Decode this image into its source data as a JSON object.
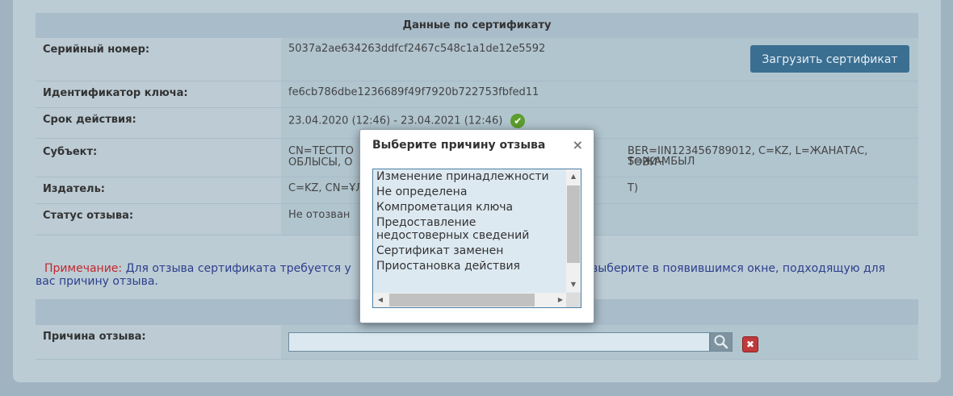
{
  "cert": {
    "section_title": "Данные по сертификату",
    "serial_label": "Серийный номер:",
    "serial_value": "5037a2ae634263ddfcf2467c548c1a1de12e5592",
    "load_button": "Загрузить сертификат",
    "key_id_label": "Идентификатор ключа:",
    "key_id_value": "fe6cb786dbe1236689f49f7920b722753fbfed11",
    "validity_label": "Срок действия:",
    "validity_value": "23.04.2020 (12:46) - 23.04.2021 (12:46)",
    "subject_label": "Субъект:",
    "subject_value_left": "CN=ТЕСТТО",
    "subject_value_left2": "ОБЛЫСЫ, О",
    "subject_value_right": "BER=IIN123456789012, C=KZ, L=ЖАНАТАС, S=ЖАМБЫЛ",
    "subject_value_right2": "ТОВИЧ",
    "issuer_label": "Издатель:",
    "issuer_value_left": "C=KZ, CN=ҰЛ",
    "issuer_value_right": "Т)",
    "revocation_status_label": "Статус отзыва:",
    "revocation_status_value": "Не отозван"
  },
  "note": {
    "prefix": "Примечание:",
    "text_left": "Для отзыва сертификата требуется у",
    "text_right": "выберите в появившимся окне, подходящую для",
    "text_line2": "вас причину отзыва."
  },
  "reason": {
    "label": "Причина отзыва:",
    "input_value": ""
  },
  "modal": {
    "title": "Выберите причину отзыва",
    "close": "×",
    "options": [
      "Изменение принадлежности",
      "Не определена",
      "Компрометация ключа",
      "Предоставление недостоверных сведений",
      "Сертификат заменен",
      "Приостановка действия"
    ]
  },
  "colors": {
    "accent": "#3a6f92",
    "success": "#5c9e2e",
    "danger": "#c0393b",
    "note_red": "#c0272d",
    "note_blue": "#2c3f8c"
  }
}
